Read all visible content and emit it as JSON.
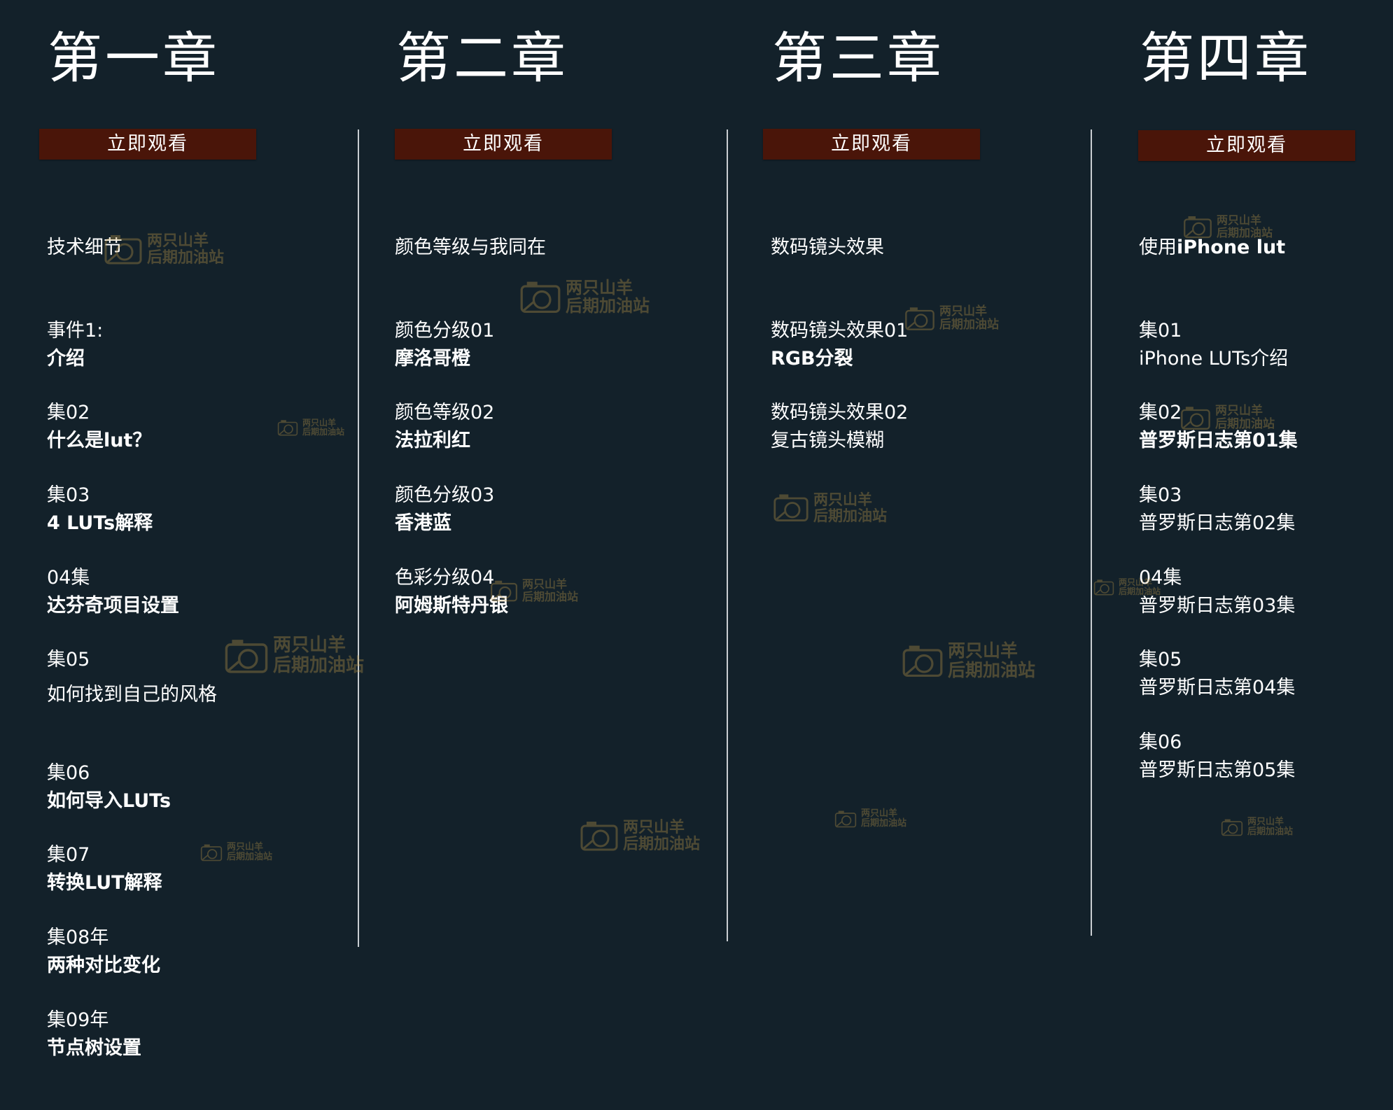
{
  "chapters": [
    {
      "title": "第一章",
      "button": "立即观看",
      "section": "技术细节",
      "episodes": [
        {
          "label": "事件1:",
          "name": "介绍",
          "bold": true
        },
        {
          "label": "集02",
          "name": "什么是lut？",
          "bold": true
        },
        {
          "label": "集03",
          "name": "4 LUTs解释",
          "bold": true
        },
        {
          "label": "04集",
          "name": "达芬奇项目设置",
          "bold": true
        },
        {
          "label": "集05",
          "name": "如何找到自己的风格",
          "bold": false
        },
        {
          "label": "集06",
          "name": "如何导入LUTs",
          "bold": true
        },
        {
          "label": "集07",
          "name": "转换LUT解释",
          "bold": true
        },
        {
          "label": "集08年",
          "name": "两种对比变化",
          "bold": true
        },
        {
          "label": "集09年",
          "name": "节点树设置",
          "bold": true
        }
      ]
    },
    {
      "title": "第二章",
      "button": "立即观看",
      "section": "颜色等级与我同在",
      "episodes": [
        {
          "label": "颜色分级01",
          "name": "摩洛哥橙",
          "bold": true
        },
        {
          "label": "颜色等级02",
          "name": "法拉利红",
          "bold": true
        },
        {
          "label": "颜色分级03",
          "name": "香港蓝",
          "bold": true
        },
        {
          "label": "色彩分级04",
          "name": "阿姆斯特丹银",
          "bold": true
        }
      ]
    },
    {
      "title": "第三章",
      "button": "立即观看",
      "section": "数码镜头效果",
      "episodes": [
        {
          "label": "数码镜头效果01",
          "name": "RGB分裂",
          "bold": true
        },
        {
          "label": "数码镜头效果02",
          "name": "复古镜头模糊",
          "bold": false
        }
      ]
    },
    {
      "title": "第四章",
      "button": "立即观看",
      "section_prefix": "使用",
      "section_bold": "iPhone lut",
      "episodes": [
        {
          "label": "集01",
          "name": "iPhone LUTs介绍",
          "bold": false
        },
        {
          "label": "集02",
          "name": "普罗斯日志第01集",
          "bold": true
        },
        {
          "label": "集03",
          "name": "普罗斯日志第02集",
          "bold": false
        },
        {
          "label": "04集",
          "name": "普罗斯日志第03集",
          "bold": false
        },
        {
          "label": "集05",
          "name": "普罗斯日志第04集",
          "bold": false
        },
        {
          "label": "集06",
          "name": "普罗斯日志第05集",
          "bold": false
        }
      ]
    }
  ],
  "watermark": {
    "line1": "两只山羊",
    "line2": "后期加油站"
  },
  "colors": {
    "background": "#13212a",
    "button": "#4a1509",
    "divider": "#c9ced2",
    "text": "#ffffff",
    "watermark": "#c9a04a"
  },
  "icons": {
    "watermark": "camera-icon"
  }
}
